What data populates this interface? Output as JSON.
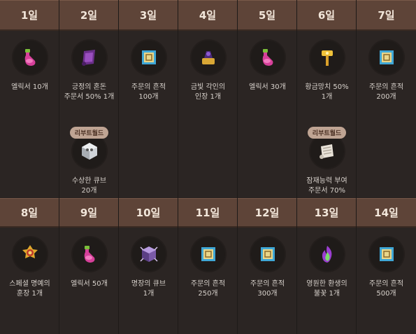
{
  "badge_label": "리부트월드",
  "days": [
    {
      "title": "1일",
      "item": "엘릭서 10개",
      "icon": "elixir-icon"
    },
    {
      "title": "2일",
      "item": "긍정의 혼돈\n주문서 50% 1개",
      "icon": "scroll-icon"
    },
    {
      "title": "3일",
      "item": "주문의 흔적\n100개",
      "icon": "spell-trace-icon"
    },
    {
      "title": "4일",
      "item": "금빛 각인의\n인장 1개",
      "icon": "golden-seal-icon"
    },
    {
      "title": "5일",
      "item": "엘릭서 30개",
      "icon": "elixir-icon"
    },
    {
      "title": "6일",
      "item": "황금망치 50%\n1개",
      "icon": "golden-hammer-icon"
    },
    {
      "title": "7일",
      "item": "주문의 흔적\n200개",
      "icon": "spell-trace-icon"
    },
    {
      "title": "8일",
      "item": "스페셜 명예의\n훈장 1개",
      "icon": "medal-icon"
    },
    {
      "title": "9일",
      "item": "엘릭서 50개",
      "icon": "elixir-icon"
    },
    {
      "title": "10일",
      "item": "명장의 큐브\n1개",
      "icon": "craftsman-cube-icon"
    },
    {
      "title": "11일",
      "item": "주문의 흔적\n250개",
      "icon": "spell-trace-icon"
    },
    {
      "title": "12일",
      "item": "주문의 흔적\n300개",
      "icon": "spell-trace-icon"
    },
    {
      "title": "13일",
      "item": "영원한 환생의\n불꽃 1개",
      "icon": "rebirth-flame-icon"
    },
    {
      "title": "14일",
      "item": "주문의 흔적\n500개",
      "icon": "spell-trace-icon"
    }
  ],
  "reboot": {
    "day2": {
      "item": "수상한 큐브\n20개",
      "icon": "strange-cube-icon"
    },
    "day6": {
      "item": "잠재능력 부여\n주문서 70%",
      "icon": "potential-scroll-icon"
    }
  }
}
